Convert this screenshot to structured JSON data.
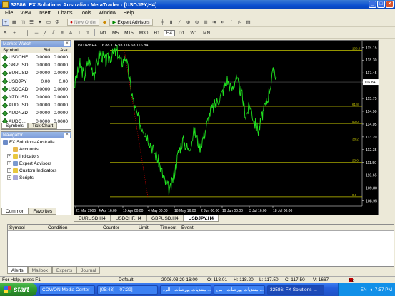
{
  "window": {
    "title": "32586: FX Solutions Australia - MetaTrader - [USDJPY,H4]"
  },
  "menu": [
    "File",
    "View",
    "Insert",
    "Charts",
    "Tools",
    "Window",
    "Help"
  ],
  "toolbar": {
    "new_order": "New Order",
    "expert_advisors": "Expert Advisors",
    "timeframes": [
      "M1",
      "M5",
      "M15",
      "M30",
      "H1",
      "H4",
      "D1",
      "W1",
      "MN"
    ],
    "active_tf": "H4"
  },
  "market_watch": {
    "title": "Market Watch",
    "headers": [
      "Symbol",
      "Bid",
      "Ask"
    ],
    "rows": [
      [
        "USDCHF",
        "0.0000",
        "0.0000"
      ],
      [
        "GBPUSD",
        "0.0000",
        "0.0000"
      ],
      [
        "EURUSD",
        "0.0000",
        "0.0000"
      ],
      [
        "USDJPY",
        "0.00",
        "0.00"
      ],
      [
        "USDCAD",
        "0.0000",
        "0.0000"
      ],
      [
        "NZDUSD",
        "0.0000",
        "0.0000"
      ],
      [
        "AUDUSD",
        "0.0000",
        "0.0000"
      ],
      [
        "AUDNZD",
        "0.0000",
        "0.0000"
      ],
      [
        "AUDC...",
        "0.0000",
        "0.0000"
      ]
    ],
    "tabs": [
      "Symbols",
      "Tick Chart"
    ]
  },
  "navigator": {
    "title": "Navigator",
    "root": "FX Solutions Australia",
    "items": [
      "Accounts",
      "Indicators",
      "Expert Advisors",
      "Custom Indicators",
      "Scripts"
    ],
    "tabs": [
      "Common",
      "Favorites"
    ]
  },
  "chart_data": {
    "type": "line",
    "title": "USDJPY,H4",
    "header": "USDJPY,H4 116.88 116.93 116.68 116.84",
    "current_price": "116.84",
    "y_ticks": [
      "119.15",
      "118.30",
      "117.45",
      "116.84",
      "115.75",
      "114.90",
      "114.05",
      "113.20",
      "112.35",
      "111.50",
      "110.65",
      "109.80",
      "108.95"
    ],
    "x_ticks": [
      "21 Mar 2006",
      "4 Apr 16:00",
      "19 Apr 00:00",
      "4 May 00:00",
      "18 May 16:00",
      "2 Jun 00:00",
      "19 Jun 00:00",
      "3 Jul 16:00",
      "18 Jul 00:00"
    ],
    "fib_levels": [
      "100.0",
      "61.8",
      "50.0",
      "38.2",
      "23.6",
      "0.0"
    ],
    "ylim": [
      108.6,
      119.4
    ]
  },
  "chart_tabs": [
    "EURUSD,H4",
    "USDCHF,H4",
    "GBPUSD,H4",
    "USDJPY,H4"
  ],
  "terminal": {
    "headers": [
      "Symbol",
      "Condition",
      "Counter",
      "Limit",
      "Timeout",
      "Event"
    ],
    "tabs": [
      "Alerts",
      "Mailbox",
      "Experts",
      "Journal"
    ],
    "side_label": "Terminal"
  },
  "status": {
    "help": "For Help, press F1",
    "profile": "Default",
    "time": "2006.03.29 16:00",
    "open": "O: 118.01",
    "high": "H: 118.20",
    "low": "L: 117.50",
    "close": "C: 117.50",
    "volume": "V: 1667",
    "connection": "No connection"
  },
  "taskbar": {
    "start": "start",
    "tasks": [
      "COWON Media Center",
      "[05:43] - [07:29]",
      "منتديات بورصات - الرد ...",
      "منتديات بورصات - من ...",
      "32586: FX Solutions ..."
    ],
    "lang": "EN",
    "clock": "7:57 PM"
  }
}
